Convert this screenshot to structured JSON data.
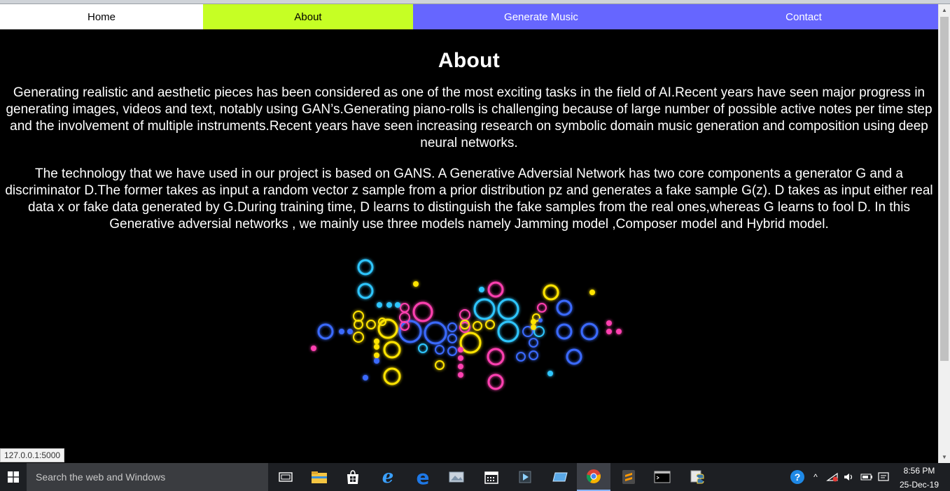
{
  "nav": {
    "items": [
      {
        "label": "Home"
      },
      {
        "label": "About"
      },
      {
        "label": "Generate Music"
      },
      {
        "label": "Contact"
      }
    ]
  },
  "main": {
    "title": "About",
    "paragraphs": [
      "Generating realistic and aesthetic pieces has been considered as one of the most exciting tasks in the field of AI.Recent years have seen major progress in generating images, videos and text, notably using GAN’s.Generating piano-rolls is challenging because of large number of possible active notes per time step and the involvement of multiple instruments.Recent years have seen increasing research on symbolic domain music generation and composition using deep neural networks.",
      "The technology that we have used in our project is based on GANS. A Generative Adversial Network has two core components a generator G and a discriminator D.The former takes as input a random vector z sample from a prior distribution pz and generates a fake sample G(z). D takes as input either real data x or fake data generated by G.During training time, D learns to distinguish the fake samples from the real ones,whereas G learns to fool D. In this Generative adversial networks , we mainly use three models namely Jamming model ,Composer model and Hybrid model."
    ]
  },
  "status_bar": {
    "url": "127.0.0.1:5000"
  },
  "taskbar": {
    "search_placeholder": "Search the web and Windows",
    "time": "8:56 PM",
    "date": "25-Dec-19"
  },
  "colors": {
    "nav_home": "#ffffff",
    "nav_about": "#c6ff24",
    "nav_generate": "#6666ff",
    "nav_contact": "#6666ff",
    "page_bg": "#000000",
    "glow_cyan": "#2ec6ff",
    "glow_blue": "#3a6bff",
    "glow_pink": "#ff3fb0",
    "glow_yellow": "#ffe400"
  }
}
